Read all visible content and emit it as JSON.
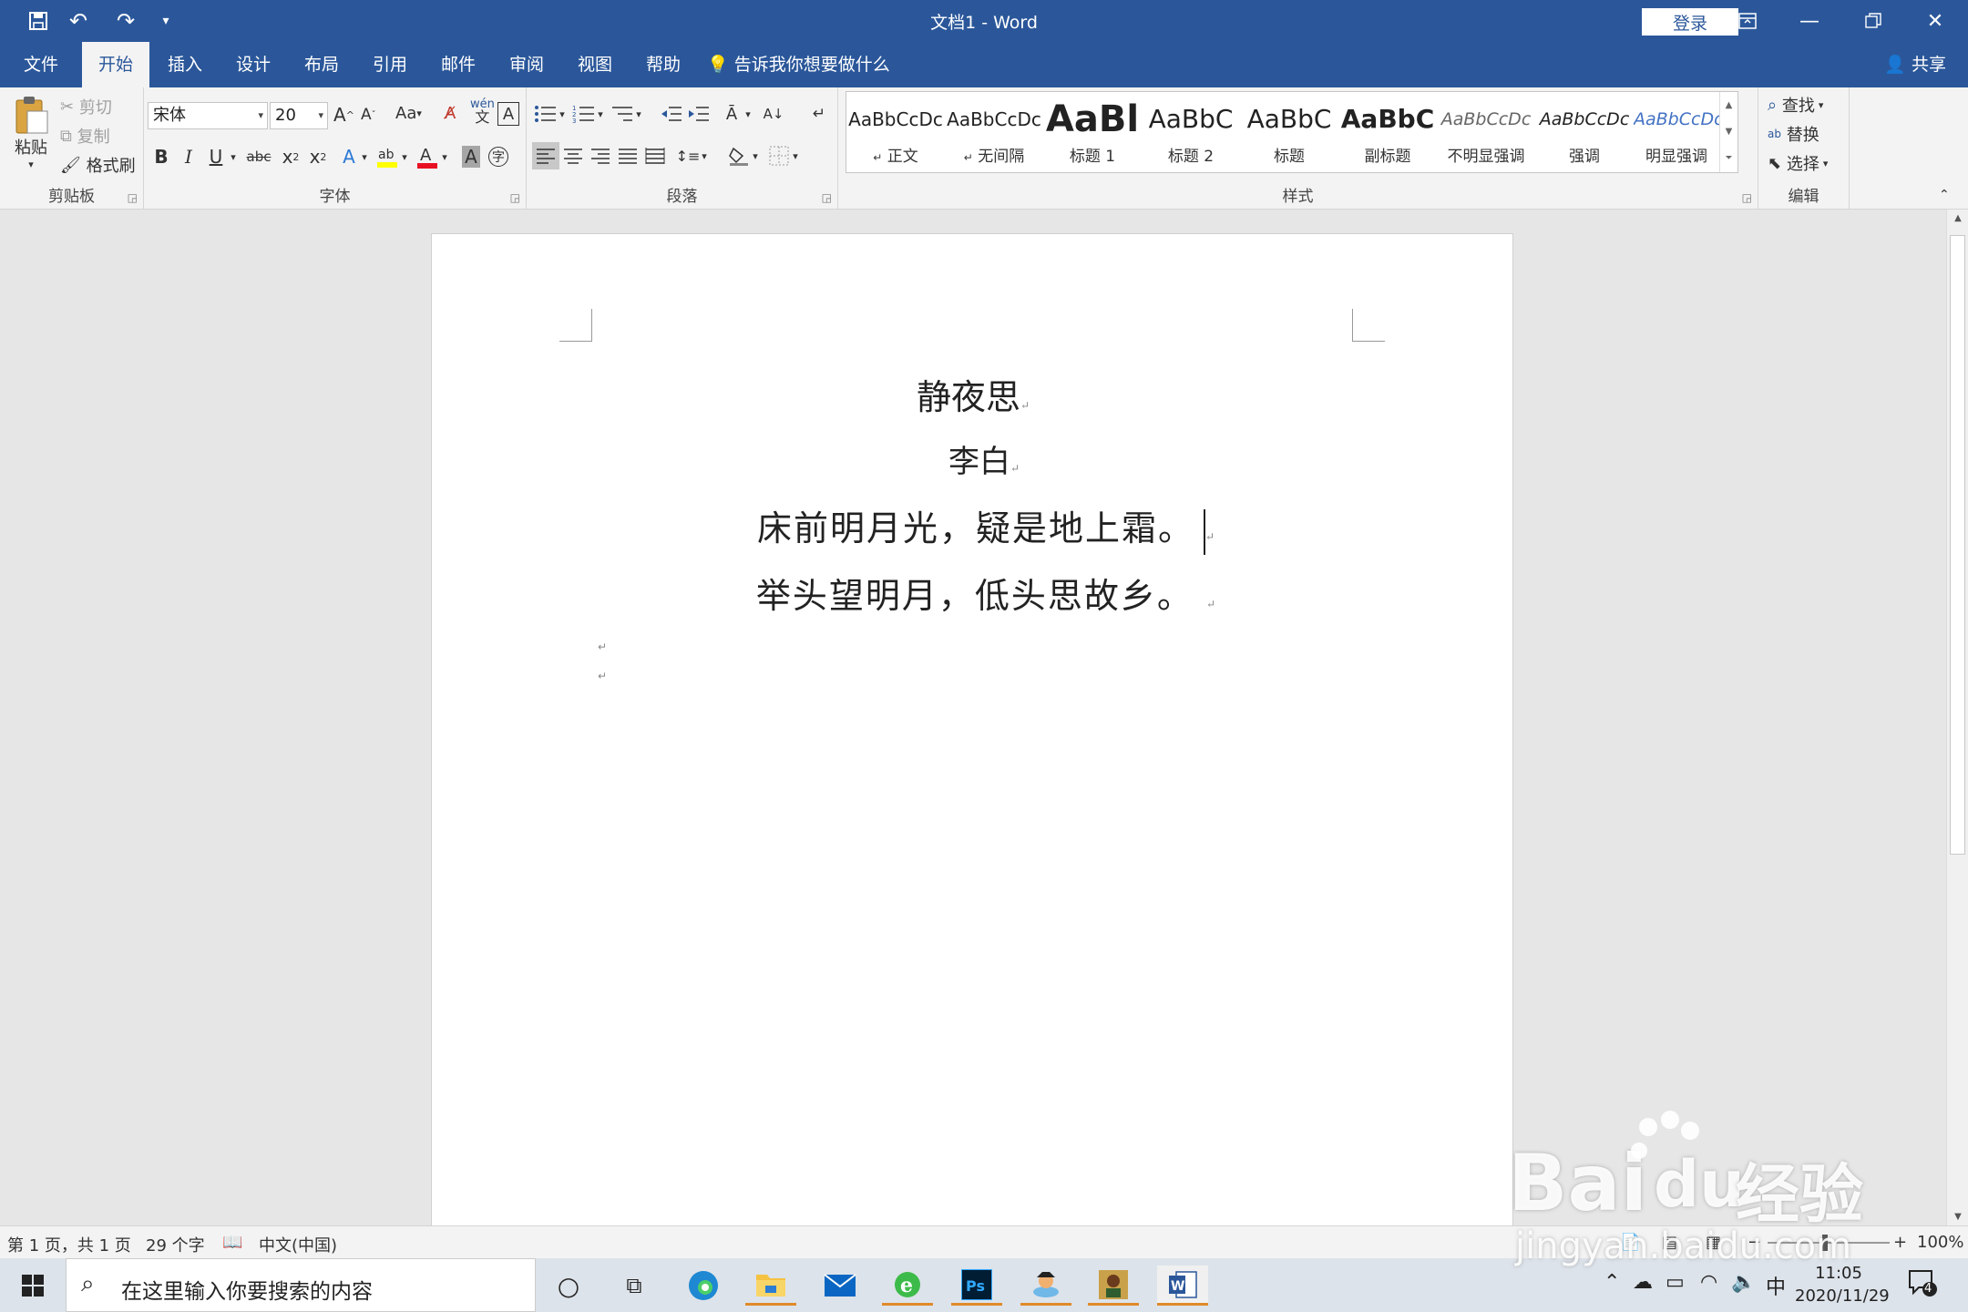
{
  "titlebar": {
    "title": "文档1  -  Word",
    "login_label": "登录"
  },
  "tabs": [
    {
      "label": "文件"
    },
    {
      "label": "开始"
    },
    {
      "label": "插入"
    },
    {
      "label": "设计"
    },
    {
      "label": "布局"
    },
    {
      "label": "引用"
    },
    {
      "label": "邮件"
    },
    {
      "label": "审阅"
    },
    {
      "label": "视图"
    },
    {
      "label": "帮助"
    }
  ],
  "active_tab": "开始",
  "tell_me": "告诉我你想要做什么",
  "share_label": "共享",
  "clipboard": {
    "paste": "粘贴",
    "cut": "剪切",
    "copy": "复制",
    "format_painter": "格式刷",
    "label": "剪贴板"
  },
  "font": {
    "name": "宋体",
    "size": "20",
    "label": "字体",
    "case_label": "Aa",
    "phonetic_top": "wén",
    "phonetic_bottom": "文",
    "bold": "B",
    "italic": "I",
    "underline": "U",
    "strike": "abc",
    "subscript": "x",
    "superscript": "x",
    "enclose": "字"
  },
  "paragraph": {
    "label": "段落"
  },
  "styles": {
    "label": "样式",
    "items": [
      {
        "preview": "AaBbCcDc",
        "name": "正文"
      },
      {
        "preview": "AaBbCcDc",
        "name": "无间隔"
      },
      {
        "preview": "AaBl",
        "name": "标题 1"
      },
      {
        "preview": "AaBbC",
        "name": "标题 2"
      },
      {
        "preview": "AaBbC",
        "name": "标题"
      },
      {
        "preview": "AaBbC",
        "name": "副标题"
      },
      {
        "preview": "AaBbCcDc",
        "name": "不明显强调"
      },
      {
        "preview": "AaBbCcDc",
        "name": "强调"
      },
      {
        "preview": "AaBbCcDc",
        "name": "明显强调"
      }
    ]
  },
  "editing": {
    "find": "查找",
    "replace": "替换",
    "select": "选择",
    "label": "编辑"
  },
  "document": {
    "title": "静夜思",
    "author": "李白",
    "line1": "床前明月光，疑是地上霜。",
    "line2": "举头望明月，低头思故乡。",
    "para_mark": "↵"
  },
  "status": {
    "page": "第 1 页，共 1 页",
    "words": "29 个字",
    "language": "中文(中国)",
    "zoom": "100%"
  },
  "taskbar": {
    "search_placeholder": "在这里输入你要搜索的内容",
    "ime": "中",
    "time": "11:05",
    "date": "2020/11/29",
    "notifications": "4"
  },
  "watermark": {
    "brand_latin": "Bai",
    "brand_du": "du",
    "brand_cn": "经验",
    "url": "jingyan.baidu.com"
  },
  "colors": {
    "word_blue": "#2b579a",
    "ribbon_bg": "#f3f3f3",
    "canvas_bg": "#e6e6e6",
    "highlight_yellow": "#ffff00",
    "font_red": "#e81123"
  }
}
